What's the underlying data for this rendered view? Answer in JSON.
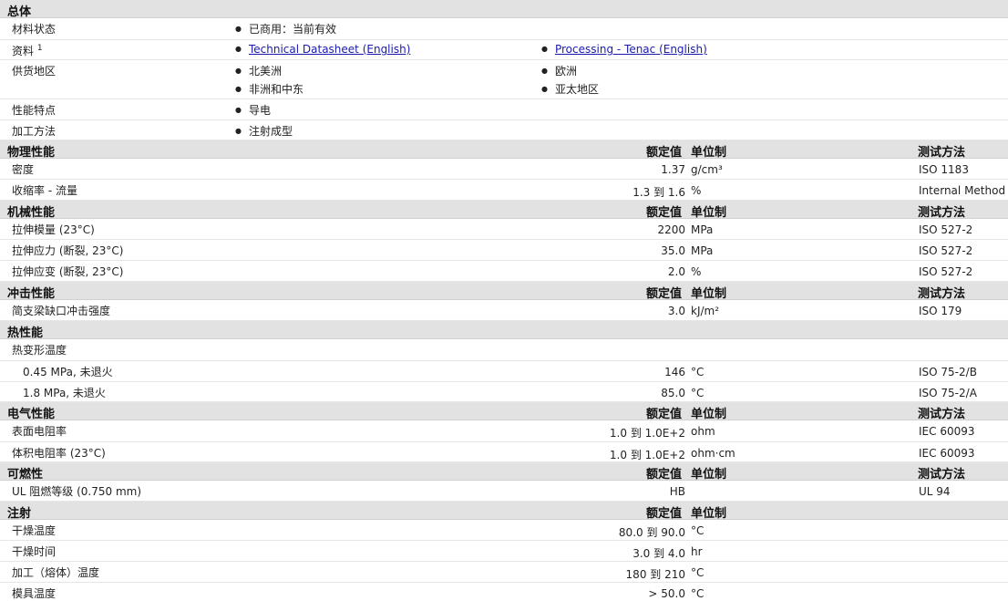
{
  "general": {
    "title": "总体",
    "status_label": "材料状态",
    "status_value": "已商用：当前有效",
    "docs_label": "资料",
    "docs_sup": "1",
    "doc_links": [
      "Technical Datasheet (English)",
      "Processing - Tenac (English)"
    ],
    "regions_label": "供货地区",
    "regions": [
      "北美洲",
      "欧洲",
      "非洲和中东",
      "亚太地区"
    ],
    "features_label": "性能特点",
    "features_value": "导电",
    "process_label": "加工方法",
    "process_value": "注射成型"
  },
  "headers": {
    "nominal": "额定值",
    "unit": "单位制",
    "test": "测试方法"
  },
  "sections": {
    "physical": {
      "title": "物理性能",
      "rows": [
        {
          "label": "密度",
          "nominal": "1.37",
          "unit": "g/cm³",
          "test": "ISO 1183"
        },
        {
          "label": "收缩率  - 流量",
          "nominal": "1.3 到  1.6",
          "unit": "%",
          "test": "Internal Method"
        }
      ]
    },
    "mechanical": {
      "title": "机械性能",
      "rows": [
        {
          "label": "拉伸模量  (23°C)",
          "nominal": "2200",
          "unit": "MPa",
          "test": "ISO 527-2"
        },
        {
          "label": "拉伸应力  (断裂, 23°C)",
          "nominal": "35.0",
          "unit": "MPa",
          "test": "ISO 527-2"
        },
        {
          "label": "拉伸应变  (断裂, 23°C)",
          "nominal": "2.0",
          "unit": "%",
          "test": "ISO 527-2"
        }
      ]
    },
    "impact": {
      "title": "冲击性能",
      "rows": [
        {
          "label": "简支梁缺口冲击强度",
          "nominal": "3.0",
          "unit": "kJ/m²",
          "test": "ISO 179"
        }
      ]
    },
    "thermal": {
      "title": "热性能",
      "group_label": "热变形温度",
      "rows": [
        {
          "label": "0.45 MPa, 未退火",
          "nominal": "146",
          "unit": "°C",
          "test": "ISO 75-2/B"
        },
        {
          "label": "1.8 MPa, 未退火",
          "nominal": "85.0",
          "unit": "°C",
          "test": "ISO 75-2/A"
        }
      ]
    },
    "electrical": {
      "title": "电气性能",
      "rows": [
        {
          "label": "表面电阻率",
          "nominal": "1.0 到  1.0E+2",
          "unit": "ohm",
          "test": "IEC 60093"
        },
        {
          "label": "体积电阻率  (23°C)",
          "nominal": "1.0 到  1.0E+2",
          "unit": "ohm·cm",
          "test": "IEC 60093"
        }
      ]
    },
    "flammability": {
      "title": "可燃性",
      "rows": [
        {
          "label": "UL 阻燃等级  (0.750 mm)",
          "nominal": "HB",
          "unit": "",
          "test": "UL 94"
        }
      ]
    },
    "injection": {
      "title": "注射",
      "rows": [
        {
          "label": "干燥温度",
          "nominal": "80.0 到  90.0",
          "unit": "°C"
        },
        {
          "label": "干燥时间",
          "nominal": "3.0 到  4.0",
          "unit": "hr"
        },
        {
          "label": "加工（熔体）温度",
          "nominal": "180 到  210",
          "unit": "°C"
        },
        {
          "label": "模具温度",
          "nominal": "> 50.0",
          "unit": "°C"
        }
      ]
    }
  }
}
